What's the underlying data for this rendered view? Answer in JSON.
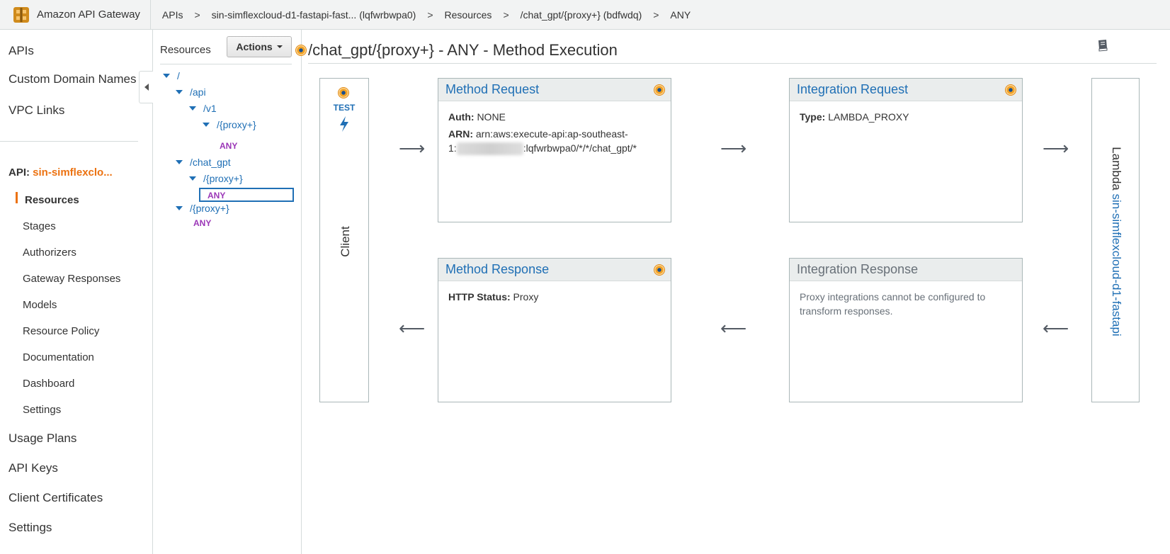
{
  "topbar": {
    "brand": "Amazon API Gateway",
    "breadcrumbs": [
      "APIs",
      "sin-simflexcloud-d1-fastapi-fast... (lqfwrbwpa0)",
      "Resources",
      "/chat_gpt/{proxy+} (bdfwdq)",
      "ANY"
    ],
    "separator": ">"
  },
  "leftnav": {
    "top_items": [
      "APIs",
      "Custom Domain Names",
      "VPC Links"
    ],
    "api_prefix": "API:",
    "api_name": "sin-simflexclo...",
    "api_items": [
      "Resources",
      "Stages",
      "Authorizers",
      "Gateway Responses",
      "Models",
      "Resource Policy",
      "Documentation",
      "Dashboard",
      "Settings"
    ],
    "bottom_items": [
      "Usage Plans",
      "API Keys",
      "Client Certificates",
      "Settings"
    ]
  },
  "resources": {
    "title": "Resources",
    "actions_label": "Actions",
    "tree": {
      "root": "/",
      "api": "/api",
      "v1": "/v1",
      "v1_proxy": "/{proxy+}",
      "v1_proxy_method": "ANY",
      "chat_gpt": "/chat_gpt",
      "chat_proxy": "/{proxy+}",
      "chat_proxy_method": "ANY",
      "root_proxy": "/{proxy+}",
      "root_proxy_method": "ANY"
    }
  },
  "main": {
    "title": "/chat_gpt/{proxy+} - ANY - Method Execution",
    "client": {
      "test_label": "TEST",
      "label": "Client"
    },
    "method_request": {
      "title": "Method Request",
      "auth_label": "Auth:",
      "auth_value": "NONE",
      "arn_label": "ARN:",
      "arn_line1": "arn:aws:execute-api:ap-southeast-",
      "arn_line2_prefix": "1:",
      "arn_line2_suffix": ":lqfwrbwpa0/*/*/chat_gpt/*"
    },
    "integration_request": {
      "title": "Integration Request",
      "type_label": "Type:",
      "type_value": "LAMBDA_PROXY"
    },
    "method_response": {
      "title": "Method Response",
      "status_label": "HTTP Status:",
      "status_value": "Proxy"
    },
    "integration_response": {
      "title": "Integration Response",
      "note": "Proxy integrations cannot be configured to transform responses."
    },
    "lambda": {
      "prefix": "Lambda",
      "function_name": "sin-simflexcloud-d1-fastapi"
    }
  },
  "colors": {
    "accent_orange": "#ec7211",
    "link_blue": "#1f6fb5",
    "method_purple": "#9b36b7"
  },
  "icons": [
    "api-gateway-logo-icon",
    "collapse-left-icon",
    "book-icon",
    "lightning-bolt-icon",
    "status-dot-icon",
    "arrow-right-icon",
    "arrow-left-icon",
    "tree-caret-icon"
  ]
}
